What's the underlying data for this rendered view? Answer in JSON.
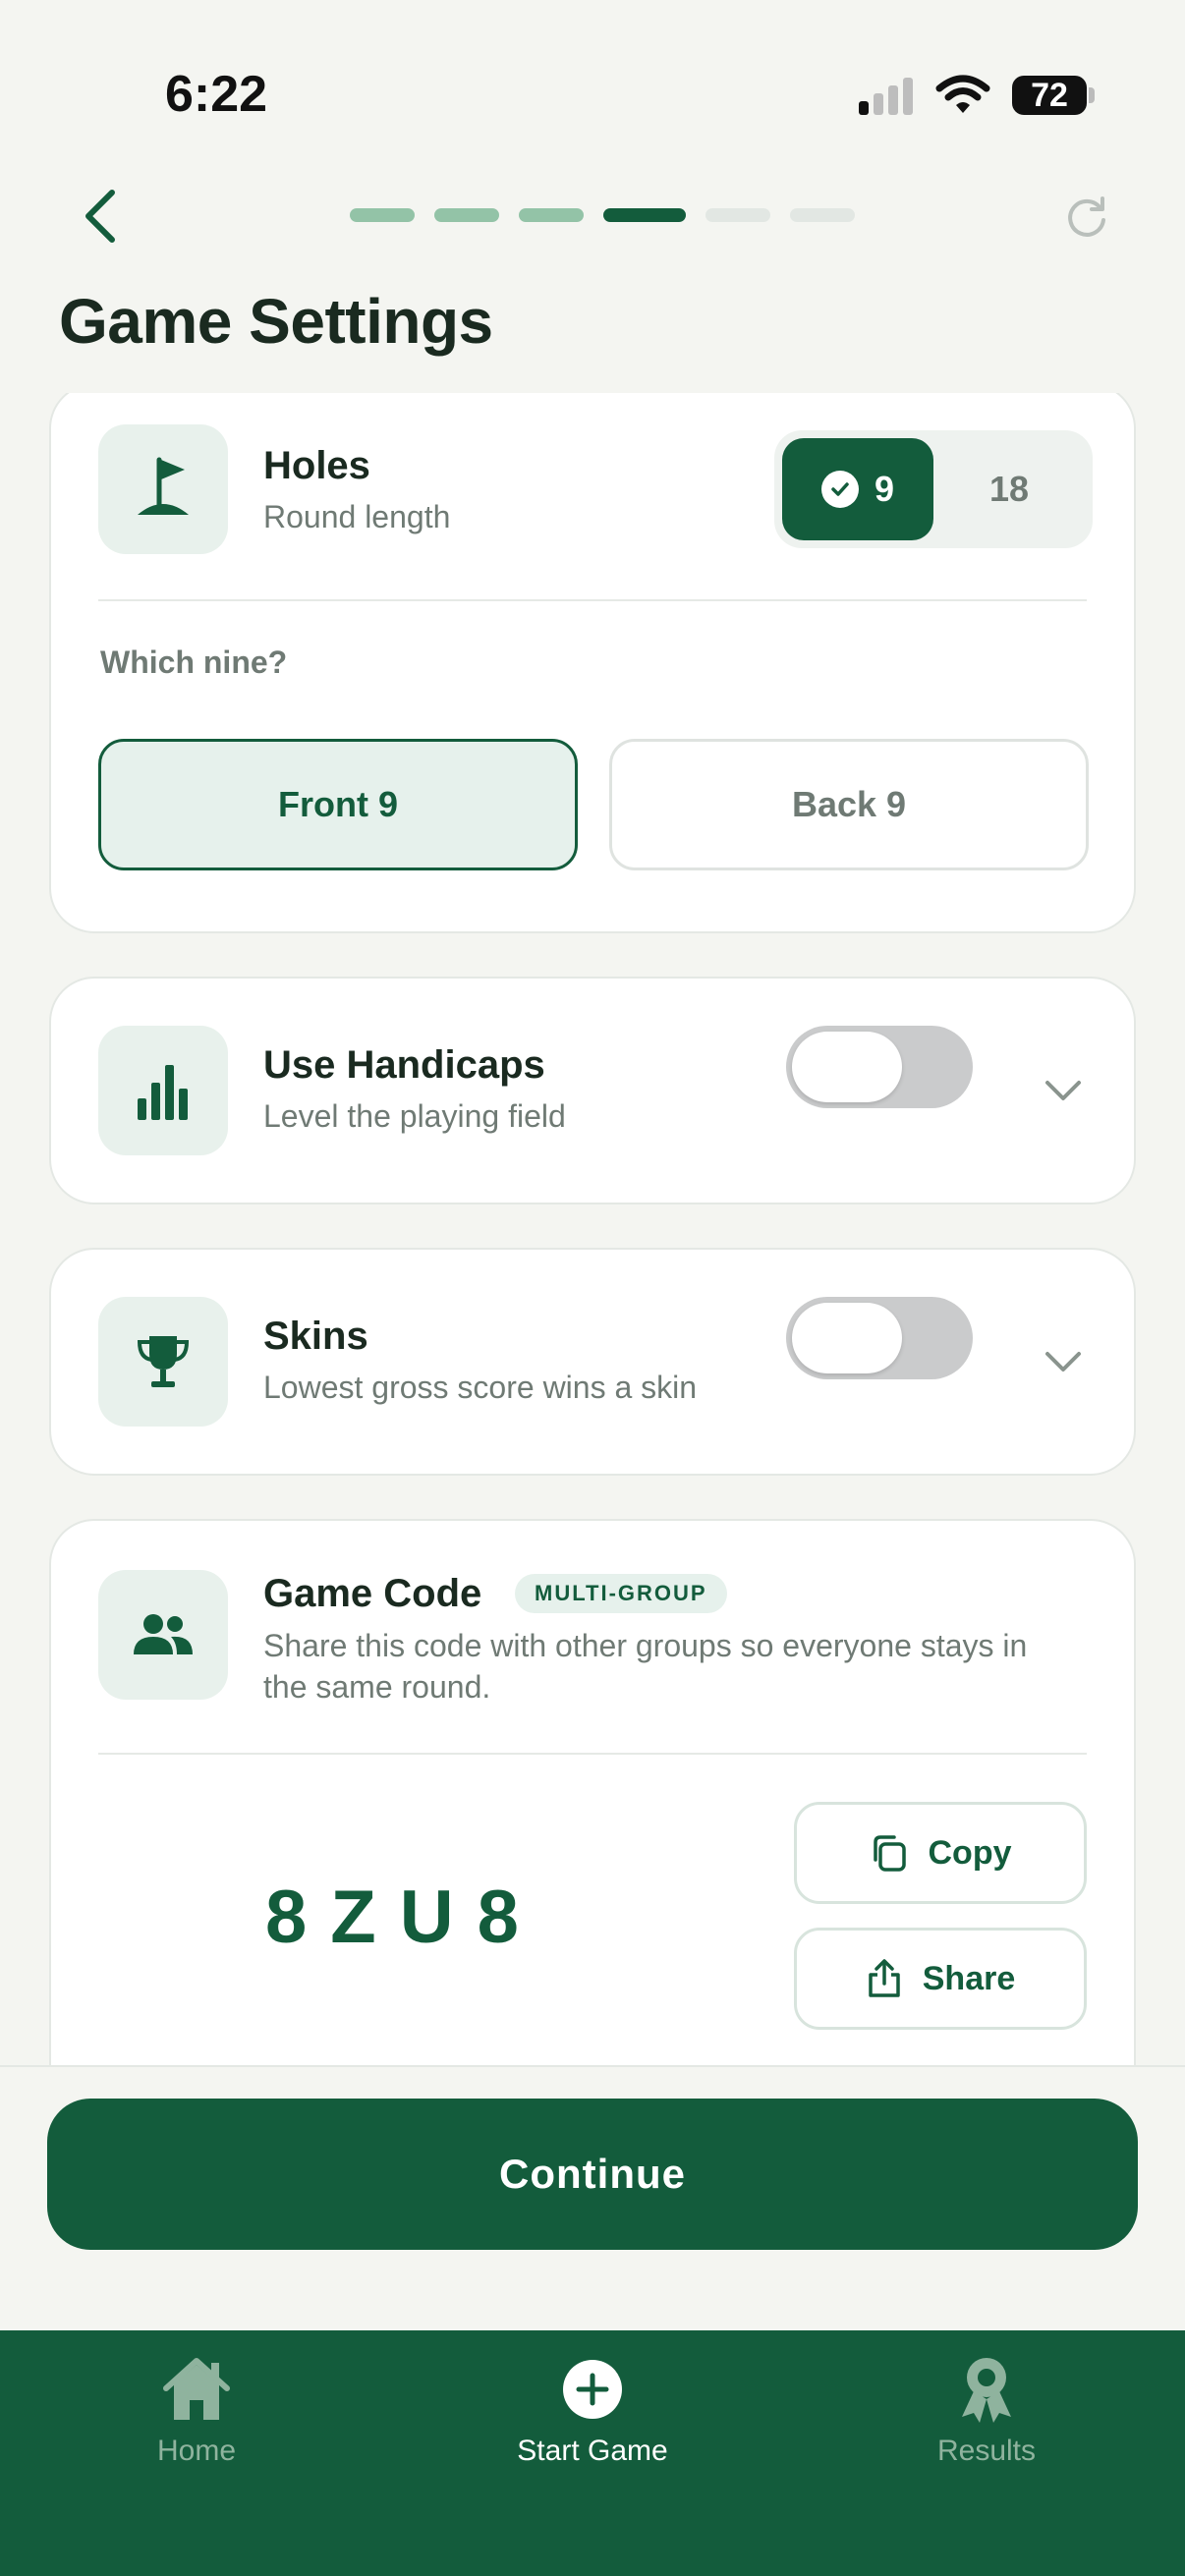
{
  "status_bar": {
    "time": "6:22",
    "battery": "72"
  },
  "header": {
    "title": "Game Settings",
    "progress": {
      "total_steps": 6,
      "completed_steps": 3,
      "current_step": 4
    }
  },
  "holes": {
    "title": "Holes",
    "subtitle": "Round length",
    "options": [
      "9",
      "18"
    ],
    "selected": "9",
    "which_nine_label": "Which nine?",
    "nine_options": [
      "Front 9",
      "Back 9"
    ],
    "selected_nine": "Front 9"
  },
  "handicaps": {
    "title": "Use Handicaps",
    "subtitle": "Level the playing field",
    "enabled": false
  },
  "skins": {
    "title": "Skins",
    "subtitle": "Lowest gross score wins a skin",
    "enabled": false
  },
  "game_code": {
    "title": "Game Code",
    "badge": "MULTI-GROUP",
    "description": "Share this code with other groups so everyone stays in the same round.",
    "code": "8ZU8",
    "copy_label": "Copy",
    "share_label": "Share"
  },
  "continue_label": "Continue",
  "tabbar": {
    "home": "Home",
    "start_game": "Start Game",
    "results": "Results",
    "active": "start_game"
  },
  "colors": {
    "brand_green": "#135c3c",
    "light_green": "#e6f1ec",
    "muted_text": "#6f7a74",
    "background": "#f4f5f1"
  }
}
